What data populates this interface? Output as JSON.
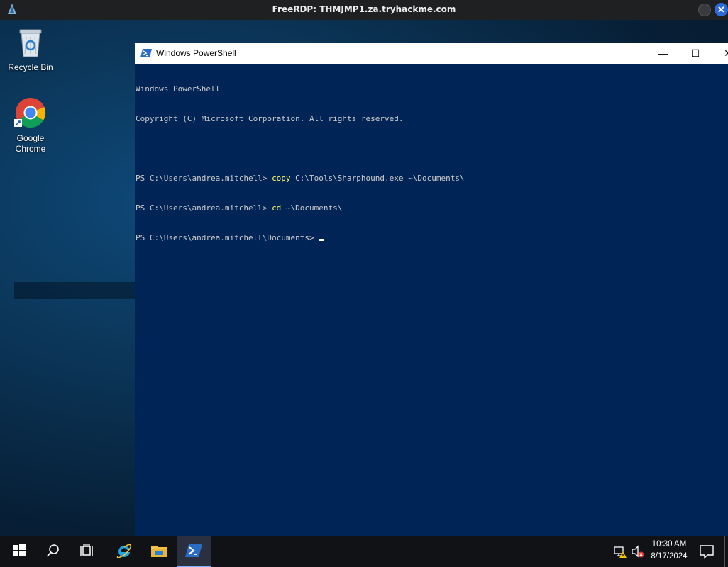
{
  "rdp": {
    "title": "FreeRDP: THMJMP1.za.tryhackme.com",
    "close_glyph": "✕",
    "icons": {
      "logo": "freerdp-logo-icon",
      "minimize": "minimize-circle-icon",
      "close": "close-circle-icon"
    }
  },
  "desktop": {
    "icons": [
      {
        "label": "Recycle Bin",
        "icon": "recycle-bin-icon"
      },
      {
        "label": "Google Chrome",
        "label_line1": "Google",
        "label_line2": "Chrome",
        "icon": "chrome-icon"
      }
    ]
  },
  "powershell": {
    "title": "Windows PowerShell",
    "controls": {
      "minimize": "—",
      "maximize": "☐",
      "close": "✕"
    },
    "console": {
      "line1": "Windows PowerShell",
      "line2": "Copyright (C) Microsoft Corporation. All rights reserved.",
      "prompt1": "PS C:\\Users\\andrea.mitchell> ",
      "cmd1": "copy",
      "args1": " C:\\Tools\\Sharphound.exe ~\\Documents\\",
      "prompt2": "PS C:\\Users\\andrea.mitchell> ",
      "cmd2": "cd",
      "args2": " ~\\Documents\\",
      "prompt3": "PS C:\\Users\\andrea.mitchell\\Documents> "
    },
    "colors": {
      "background": "#012456",
      "text": "#cccccc",
      "command": "#ffff66"
    }
  },
  "taskbar": {
    "items": [
      {
        "icon": "windows-start-icon"
      },
      {
        "icon": "search-icon"
      },
      {
        "icon": "task-view-icon"
      },
      {
        "icon": "internet-explorer-icon"
      },
      {
        "icon": "file-explorer-icon"
      },
      {
        "icon": "powershell-icon",
        "active": true
      }
    ],
    "tray": {
      "network": "network-warning-icon",
      "volume": "volume-muted-icon",
      "notifications": "action-center-icon"
    },
    "clock": {
      "time": "10:30 AM",
      "date": "8/17/2024"
    }
  }
}
